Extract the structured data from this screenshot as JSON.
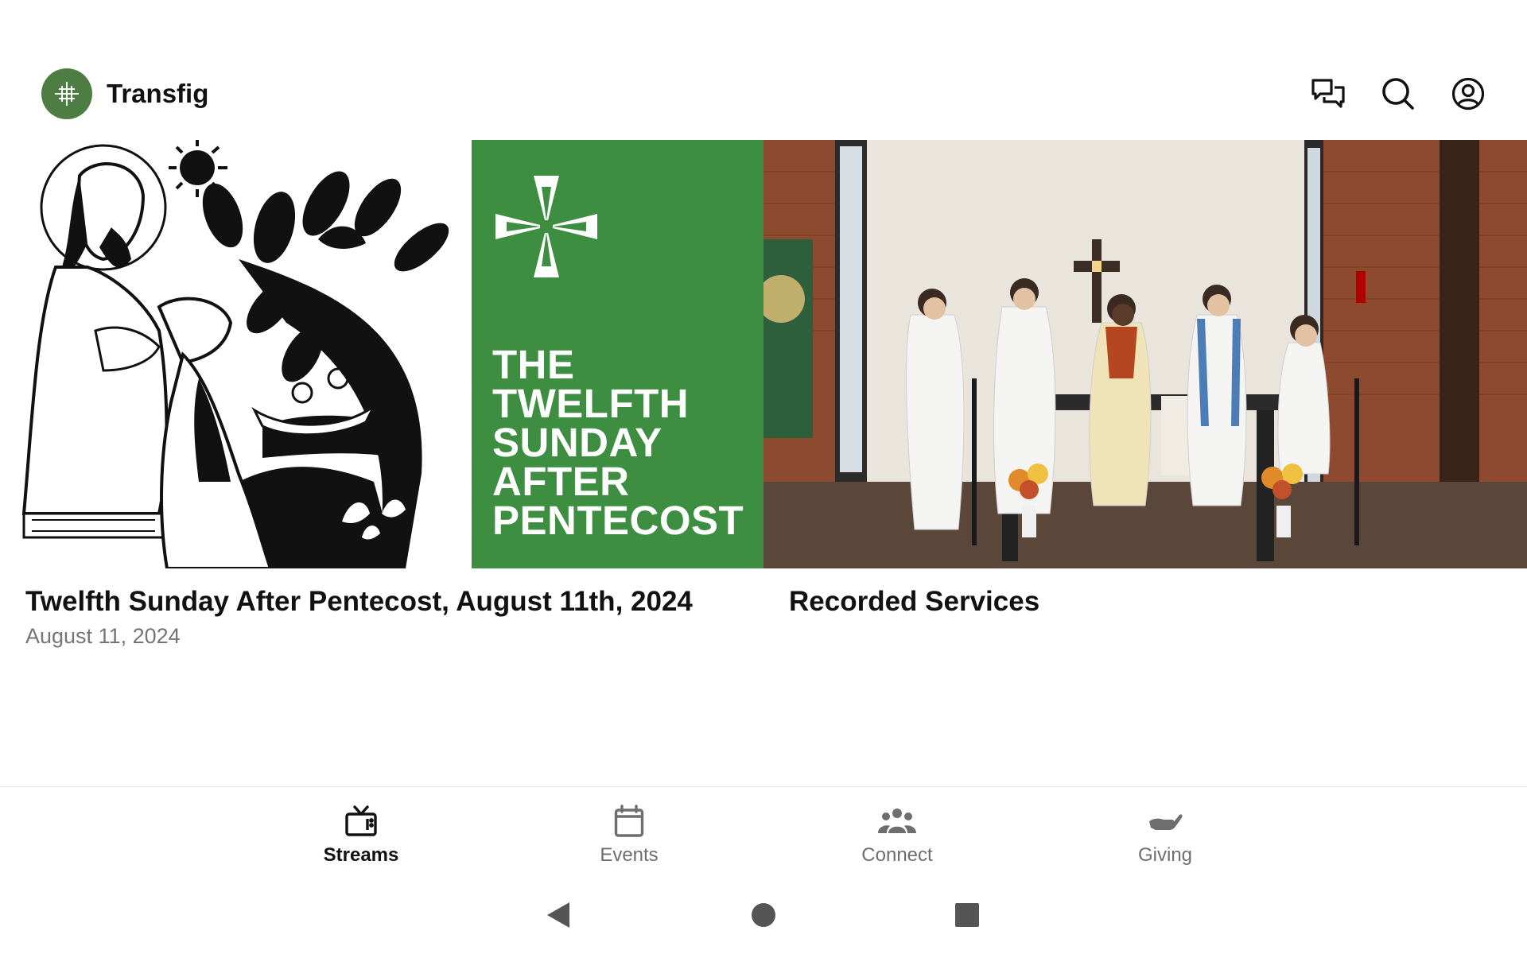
{
  "app": {
    "title": "Transfig",
    "logo_icon": "church-cross-logo-icon",
    "accent_green": "#4d7d43"
  },
  "toolbar": {
    "icons": [
      "chat-icon",
      "search-icon",
      "account-icon"
    ]
  },
  "cards": [
    {
      "title": "Twelfth Sunday After Pentecost, August 11th, 2024",
      "date": "August 11, 2024",
      "thumbnail": {
        "banner_text": "THE\nTWELFTH\nSUNDAY\nAFTER\nPENTECOST",
        "banner_color": "#3e8e41"
      }
    },
    {
      "title": "Recorded Services"
    }
  ],
  "bottom_nav": {
    "items": [
      {
        "label": "Streams",
        "icon": "tv-icon",
        "active": true
      },
      {
        "label": "Events",
        "icon": "calendar-icon",
        "active": false
      },
      {
        "label": "Connect",
        "icon": "people-icon",
        "active": false
      },
      {
        "label": "Giving",
        "icon": "giving-hand-icon",
        "active": false
      }
    ]
  },
  "system_nav": [
    "back-icon",
    "home-icon",
    "recents-icon"
  ]
}
